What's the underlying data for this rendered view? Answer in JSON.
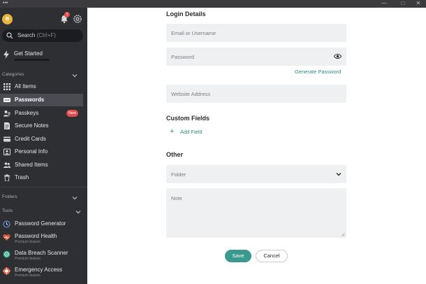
{
  "window": {
    "menu_dots": "•••",
    "minimize": "—",
    "maximize": "□",
    "close": "✕"
  },
  "sidebar": {
    "avatar_initial": "B",
    "notification_count": "1",
    "search": {
      "label": "Search",
      "shortcut": "(Ctrl+F)"
    },
    "get_started": "Get Started",
    "categories_label": "Categories",
    "items": [
      {
        "label": "All Items",
        "icon": "grid-icon"
      },
      {
        "label": "Passwords",
        "icon": "password-icon",
        "active": true
      },
      {
        "label": "Passkeys",
        "icon": "passkey-icon",
        "badge": "New"
      },
      {
        "label": "Secure Notes",
        "icon": "note-icon"
      },
      {
        "label": "Credit Cards",
        "icon": "credit-card-icon"
      },
      {
        "label": "Personal Info",
        "icon": "id-card-icon"
      },
      {
        "label": "Shared Items",
        "icon": "shared-icon"
      },
      {
        "label": "Trash",
        "icon": "trash-icon"
      }
    ],
    "folders_label": "Folders",
    "tools_label": "Tools",
    "tools": [
      {
        "label": "Password Generator",
        "sub": "",
        "icon": "generator-icon"
      },
      {
        "label": "Password Health",
        "sub": "Premium feature",
        "icon": "health-icon"
      },
      {
        "label": "Data Breach Scanner",
        "sub": "Premium feature",
        "icon": "scanner-icon"
      },
      {
        "label": "Emergency Access",
        "sub": "Premium feature",
        "icon": "emergency-icon"
      }
    ]
  },
  "form": {
    "login_details": "Login Details",
    "email_placeholder": "Email or Username",
    "password_placeholder": "Password",
    "generate_password": "Generate Password",
    "website_placeholder": "Website Address",
    "custom_fields": "Custom Fields",
    "add_field": "Add Field",
    "other": "Other",
    "folder_placeholder": "Folder",
    "note_placeholder": "Note",
    "save": "Save",
    "cancel": "Cancel"
  },
  "colors": {
    "accent": "#3b9a8f",
    "sidebar_bg": "#2d2f33",
    "badge": "#e24c4c"
  }
}
